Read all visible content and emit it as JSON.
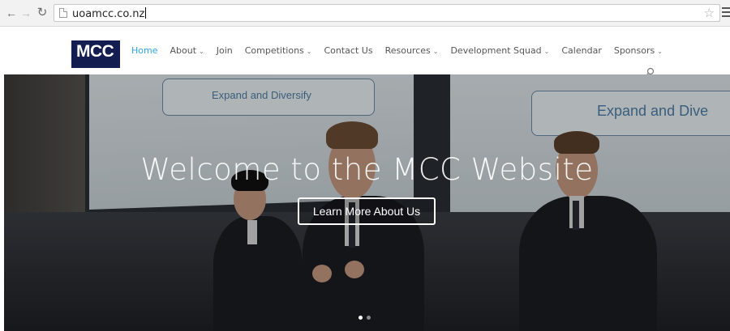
{
  "browser": {
    "url": "uoamcc.co.nz"
  },
  "site": {
    "logo_text": "MCC",
    "nav": [
      {
        "label": "Home",
        "dropdown": false,
        "active": true
      },
      {
        "label": "About",
        "dropdown": true,
        "active": false
      },
      {
        "label": "Join",
        "dropdown": false,
        "active": false
      },
      {
        "label": "Competitions",
        "dropdown": true,
        "active": false
      },
      {
        "label": "Contact Us",
        "dropdown": false,
        "active": false
      },
      {
        "label": "Resources",
        "dropdown": true,
        "active": false
      },
      {
        "label": "Development Squad",
        "dropdown": true,
        "active": false
      },
      {
        "label": "Calendar",
        "dropdown": false,
        "active": false
      },
      {
        "label": "Sponsors",
        "dropdown": true,
        "active": false
      }
    ],
    "dropdown_glyph": "⌄",
    "accent_color": "#2ea3f2",
    "logo_color": "#131d4f"
  },
  "hero": {
    "slide_text_left": "Expand and Diversify",
    "slide_text_right": "Expand and Dive",
    "title": "Welcome to the MCC Website",
    "button_label": "Learn More About Us",
    "slides_count": 2,
    "active_slide": 1
  },
  "icons": {
    "back": "back-arrow-icon",
    "forward": "forward-arrow-icon",
    "reload": "reload-icon",
    "page": "page-icon",
    "star": "bookmark-star-icon",
    "menu": "menu-icon",
    "search": "search-icon"
  }
}
